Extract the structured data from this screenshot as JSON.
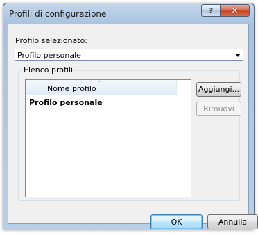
{
  "window": {
    "title": "Profili di configurazione",
    "help_glyph": "?",
    "close_glyph": "✕"
  },
  "profile_selector": {
    "label": "Profilo selezionato:",
    "selected_value": "Profilo personale"
  },
  "profile_list": {
    "group_label": "Elenco profili",
    "column_header": "Nome profilo",
    "sort_glyph": "⌃",
    "rows": [
      "Profilo personale"
    ]
  },
  "buttons": {
    "add": "Aggiungi...",
    "remove": "Rimuovi",
    "ok": "OK",
    "cancel": "Annulla"
  }
}
